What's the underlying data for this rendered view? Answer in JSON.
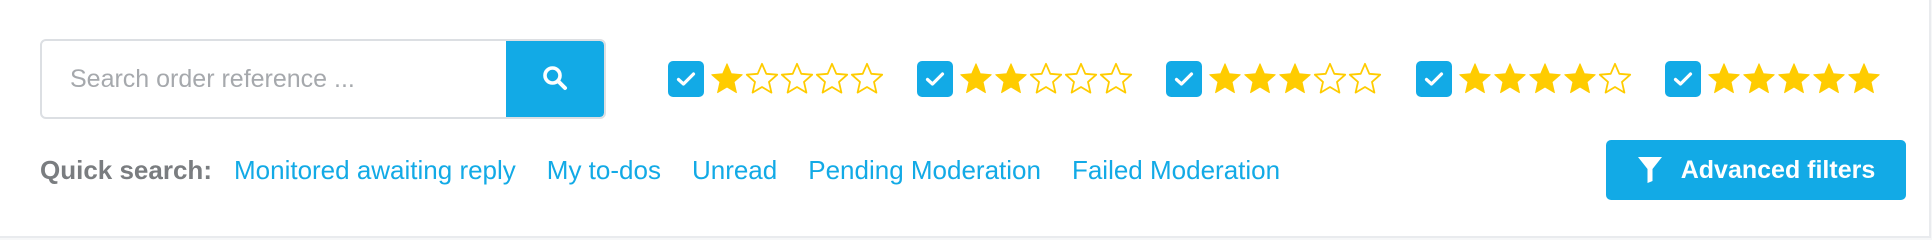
{
  "search": {
    "placeholder": "Search order reference ...",
    "value": "",
    "button_icon": "search-icon"
  },
  "rating_filters": [
    {
      "stars": 1,
      "checked": true
    },
    {
      "stars": 2,
      "checked": true
    },
    {
      "stars": 3,
      "checked": true
    },
    {
      "stars": 4,
      "checked": true
    },
    {
      "stars": 5,
      "checked": true
    }
  ],
  "quick_search": {
    "label": "Quick search:",
    "links": [
      "Monitored awaiting reply",
      "My to-dos",
      "Unread",
      "Pending Moderation",
      "Failed Moderation"
    ]
  },
  "advanced_filters": {
    "label": "Advanced filters",
    "icon": "filter-icon"
  },
  "colors": {
    "accent": "#12aae6",
    "star": "#ffcc00",
    "label": "#7a7d80"
  }
}
